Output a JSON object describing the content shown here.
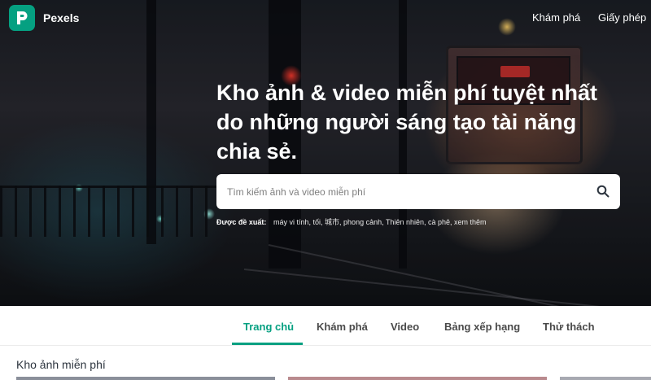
{
  "brand": {
    "name": "Pexels",
    "color": "#05a081"
  },
  "nav": [
    {
      "label": "Khám phá"
    },
    {
      "label": "Giấy phép"
    }
  ],
  "hero": {
    "headline": "Kho ảnh & video miễn phí tuyệt nhất do những người sáng tạo tài năng chia sẻ."
  },
  "search": {
    "placeholder": "Tìm kiếm ảnh và video miễn phí",
    "icon": "search-icon"
  },
  "suggestions": {
    "label": "Được đề xuất:",
    "items": [
      "máy vi tính,",
      "tối,",
      "城市,",
      "phong cảnh,",
      "Thiên nhiên,",
      "cà phê,",
      "xem thêm"
    ]
  },
  "tabs": [
    {
      "label": "Trang chủ",
      "active": true
    },
    {
      "label": "Khám phá",
      "active": false
    },
    {
      "label": "Video",
      "active": false
    },
    {
      "label": "Bảng xếp hạng",
      "active": false
    },
    {
      "label": "Thử thách",
      "active": false
    }
  ],
  "section": {
    "title": "Kho ảnh miễn phí"
  }
}
